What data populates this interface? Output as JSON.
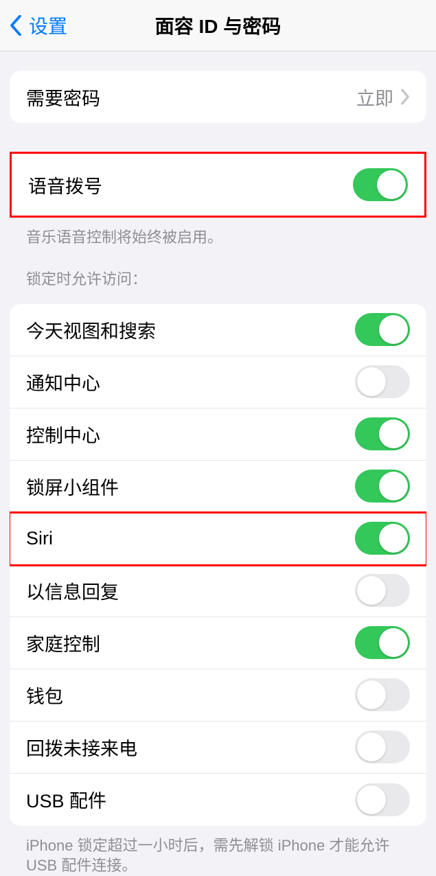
{
  "nav": {
    "back_label": "设置",
    "title": "面容 ID 与密码"
  },
  "passcode": {
    "label": "需要密码",
    "value": "立即"
  },
  "voice_dial": {
    "label": "语音拨号",
    "on": true,
    "footer": "音乐语音控制将始终被启用。"
  },
  "lock_access": {
    "header": "锁定时允许访问：",
    "items": [
      {
        "label": "今天视图和搜索",
        "on": true
      },
      {
        "label": "通知中心",
        "on": false
      },
      {
        "label": "控制中心",
        "on": true
      },
      {
        "label": "锁屏小组件",
        "on": true
      },
      {
        "label": "Siri",
        "on": true
      },
      {
        "label": "以信息回复",
        "on": false
      },
      {
        "label": "家庭控制",
        "on": true
      },
      {
        "label": "钱包",
        "on": false
      },
      {
        "label": "回拨未接来电",
        "on": false
      },
      {
        "label": "USB 配件",
        "on": false
      }
    ],
    "footer": "iPhone 锁定超过一小时后，需先解锁 iPhone 才能允许 USB 配件连接。"
  }
}
